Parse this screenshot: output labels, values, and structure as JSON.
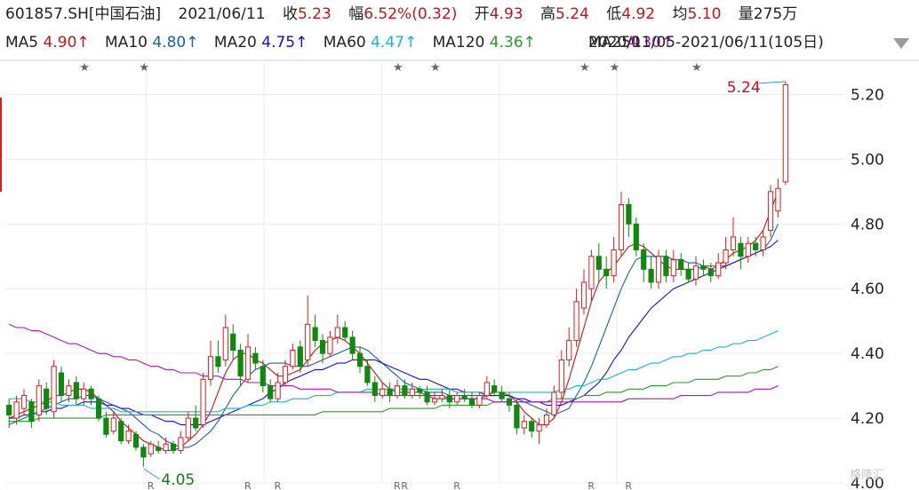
{
  "header": {
    "symbol": "601857.SH[中国石油]",
    "date": "2021/06/11",
    "close_label": "收",
    "close": "5.23",
    "change_label": "幅",
    "change": "6.52%(0.32)",
    "open_label": "开",
    "open": "4.93",
    "high_label": "高",
    "high": "5.24",
    "low_label": "低",
    "low": "4.92",
    "avg_label": "均",
    "avg": "5.10",
    "volume_label": "量",
    "volume": "275万",
    "range_text": "2020/11/05-2021/06/11(105日)"
  },
  "ma_legend": [
    {
      "name": "MA5",
      "value": "4.90",
      "arrow": "↑",
      "color": "#c0151c"
    },
    {
      "name": "MA10",
      "value": "4.80",
      "arrow": "↑",
      "color": "#1a5fa3"
    },
    {
      "name": "MA20",
      "value": "4.75",
      "arrow": "↑",
      "color": "#1111cc"
    },
    {
      "name": "MA60",
      "value": "4.47",
      "arrow": "↑",
      "color": "#1bb5c5"
    },
    {
      "name": "MA120",
      "value": "4.36",
      "arrow": "↑",
      "color": "#2b9a2b"
    },
    {
      "name": "MA250",
      "value": "4.30",
      "arrow": "↑",
      "color": "#a21ab0"
    }
  ],
  "colors": {
    "up": "#d81e1e",
    "down": "#0d8a0d",
    "grid": "#ececec",
    "text": "#222222",
    "value_red": "#c0151c"
  },
  "watermark": "格隆汇",
  "chart_data": {
    "type": "candlestick",
    "x_start": "2020/11/05",
    "x_end": "2021/06/11",
    "ylim": [
      4.0,
      5.3
    ],
    "yticks": [
      "4.00",
      "4.20",
      "4.40",
      "4.60",
      "4.80",
      "5.00",
      "5.20"
    ],
    "annotations": [
      {
        "label": "5.24",
        "type": "high"
      },
      {
        "label": "4.05",
        "type": "low"
      }
    ],
    "star_marks": 8,
    "r_marks": 9,
    "candles": [
      [
        4.24,
        4.21,
        4.26,
        4.17
      ],
      [
        4.2,
        4.25,
        4.27,
        4.18
      ],
      [
        4.23,
        4.27,
        4.29,
        4.21
      ],
      [
        4.25,
        4.19,
        4.26,
        4.17
      ],
      [
        4.21,
        4.3,
        4.32,
        4.19
      ],
      [
        4.29,
        4.23,
        4.31,
        4.21
      ],
      [
        4.22,
        4.36,
        4.38,
        4.2
      ],
      [
        4.34,
        4.27,
        4.36,
        4.25
      ],
      [
        4.27,
        4.3,
        4.32,
        4.25
      ],
      [
        4.31,
        4.26,
        4.33,
        4.24
      ],
      [
        4.26,
        4.29,
        4.31,
        4.24
      ],
      [
        4.29,
        4.26,
        4.3,
        4.24
      ],
      [
        4.26,
        4.2,
        4.27,
        4.19
      ],
      [
        4.2,
        4.15,
        4.22,
        4.14
      ],
      [
        4.16,
        4.2,
        4.22,
        4.15
      ],
      [
        4.19,
        4.13,
        4.2,
        4.12
      ],
      [
        4.13,
        4.16,
        4.18,
        4.12
      ],
      [
        4.15,
        4.11,
        4.16,
        4.1
      ],
      [
        4.11,
        4.08,
        4.12,
        4.05
      ],
      [
        4.09,
        4.12,
        4.13,
        4.08
      ],
      [
        4.11,
        4.1,
        4.13,
        4.09
      ],
      [
        4.1,
        4.12,
        4.14,
        4.09
      ],
      [
        4.12,
        4.1,
        4.13,
        4.09
      ],
      [
        4.1,
        4.14,
        4.16,
        4.09
      ],
      [
        4.14,
        4.2,
        4.22,
        4.13
      ],
      [
        4.2,
        4.17,
        4.24,
        4.16
      ],
      [
        4.18,
        4.32,
        4.34,
        4.17
      ],
      [
        4.32,
        4.39,
        4.44,
        4.3
      ],
      [
        4.39,
        4.36,
        4.44,
        4.34
      ],
      [
        4.38,
        4.48,
        4.52,
        4.36
      ],
      [
        4.46,
        4.41,
        4.49,
        4.38
      ],
      [
        4.41,
        4.33,
        4.43,
        4.3
      ],
      [
        4.32,
        4.42,
        4.46,
        4.31
      ],
      [
        4.4,
        4.37,
        4.42,
        4.35
      ],
      [
        4.36,
        4.3,
        4.38,
        4.28
      ],
      [
        4.3,
        4.26,
        4.32,
        4.25
      ],
      [
        4.26,
        4.31,
        4.34,
        4.25
      ],
      [
        4.31,
        4.36,
        4.38,
        4.3
      ],
      [
        4.36,
        4.41,
        4.43,
        4.35
      ],
      [
        4.42,
        4.36,
        4.44,
        4.34
      ],
      [
        4.38,
        4.49,
        4.58,
        4.36
      ],
      [
        4.48,
        4.44,
        4.52,
        4.42
      ],
      [
        4.44,
        4.4,
        4.46,
        4.37
      ],
      [
        4.4,
        4.45,
        4.47,
        4.39
      ],
      [
        4.45,
        4.48,
        4.52,
        4.43
      ],
      [
        4.48,
        4.45,
        4.5,
        4.44
      ],
      [
        4.45,
        4.4,
        4.47,
        4.38
      ],
      [
        4.4,
        4.36,
        4.42,
        4.34
      ],
      [
        4.36,
        4.31,
        4.38,
        4.3
      ],
      [
        4.31,
        4.27,
        4.33,
        4.25
      ],
      [
        4.27,
        4.29,
        4.31,
        4.26
      ],
      [
        4.29,
        4.27,
        4.31,
        4.25
      ],
      [
        4.27,
        4.3,
        4.32,
        4.26
      ],
      [
        4.3,
        4.27,
        4.32,
        4.26
      ],
      [
        4.27,
        4.29,
        4.31,
        4.26
      ],
      [
        4.29,
        4.28,
        4.3,
        4.26
      ],
      [
        4.28,
        4.25,
        4.3,
        4.24
      ],
      [
        4.25,
        4.26,
        4.28,
        4.24
      ],
      [
        4.26,
        4.27,
        4.29,
        4.25
      ],
      [
        4.27,
        4.25,
        4.29,
        4.23
      ],
      [
        4.25,
        4.27,
        4.28,
        4.24
      ],
      [
        4.27,
        4.26,
        4.29,
        4.25
      ],
      [
        4.26,
        4.24,
        4.28,
        4.23
      ],
      [
        4.24,
        4.27,
        4.28,
        4.23
      ],
      [
        4.27,
        4.31,
        4.33,
        4.26
      ],
      [
        4.3,
        4.28,
        4.32,
        4.27
      ],
      [
        4.28,
        4.26,
        4.3,
        4.25
      ],
      [
        4.26,
        4.24,
        4.28,
        4.22
      ],
      [
        4.24,
        4.17,
        4.26,
        4.15
      ],
      [
        4.17,
        4.19,
        4.21,
        4.15
      ],
      [
        4.19,
        4.16,
        4.2,
        4.14
      ],
      [
        4.16,
        4.18,
        4.2,
        4.12
      ],
      [
        4.18,
        4.21,
        4.23,
        4.17
      ],
      [
        4.21,
        4.28,
        4.3,
        4.2
      ],
      [
        4.28,
        4.38,
        4.41,
        4.26
      ],
      [
        4.38,
        4.44,
        4.48,
        4.36
      ],
      [
        4.44,
        4.56,
        4.6,
        4.42
      ],
      [
        4.54,
        4.62,
        4.66,
        4.52
      ],
      [
        4.6,
        4.7,
        4.72,
        4.56
      ],
      [
        4.7,
        4.66,
        4.74,
        4.62
      ],
      [
        4.66,
        4.64,
        4.7,
        4.6
      ],
      [
        4.64,
        4.72,
        4.76,
        4.62
      ],
      [
        4.72,
        4.86,
        4.9,
        4.7
      ],
      [
        4.86,
        4.8,
        4.88,
        4.76
      ],
      [
        4.8,
        4.72,
        4.82,
        4.7
      ],
      [
        4.72,
        4.66,
        4.74,
        4.62
      ],
      [
        4.66,
        4.62,
        4.7,
        4.6
      ],
      [
        4.62,
        4.7,
        4.72,
        4.6
      ],
      [
        4.7,
        4.64,
        4.72,
        4.62
      ],
      [
        4.64,
        4.69,
        4.72,
        4.62
      ],
      [
        4.69,
        4.66,
        4.71,
        4.64
      ],
      [
        4.66,
        4.63,
        4.68,
        4.62
      ],
      [
        4.63,
        4.67,
        4.7,
        4.61
      ],
      [
        4.67,
        4.66,
        4.69,
        4.64
      ],
      [
        4.66,
        4.64,
        4.68,
        4.62
      ],
      [
        4.64,
        4.68,
        4.71,
        4.63
      ],
      [
        4.68,
        4.72,
        4.76,
        4.66
      ],
      [
        4.72,
        4.76,
        4.82,
        4.7
      ],
      [
        4.74,
        4.7,
        4.76,
        4.66
      ],
      [
        4.7,
        4.74,
        4.76,
        4.68
      ],
      [
        4.74,
        4.72,
        4.76,
        4.7
      ],
      [
        4.72,
        4.76,
        4.78,
        4.7
      ],
      [
        4.78,
        4.9,
        4.92,
        4.76
      ],
      [
        4.84,
        4.91,
        4.94,
        4.82
      ],
      [
        4.93,
        5.23,
        5.24,
        4.92
      ]
    ],
    "series": [
      {
        "name": "MA5",
        "values": [
          4.2,
          4.21,
          4.22,
          4.23,
          4.24,
          4.25,
          4.27,
          4.27,
          4.28,
          4.29,
          4.29,
          4.28,
          4.26,
          4.24,
          4.22,
          4.19,
          4.17,
          4.15,
          4.13,
          4.12,
          4.11,
          4.1,
          4.1,
          4.11,
          4.13,
          4.15,
          4.18,
          4.22,
          4.28,
          4.34,
          4.38,
          4.4,
          4.4,
          4.38,
          4.37,
          4.35,
          4.33,
          4.33,
          4.34,
          4.35,
          4.38,
          4.41,
          4.43,
          4.44,
          4.45,
          4.44,
          4.42,
          4.4,
          4.37,
          4.34,
          4.31,
          4.29,
          4.28,
          4.28,
          4.28,
          4.28,
          4.27,
          4.27,
          4.27,
          4.26,
          4.26,
          4.26,
          4.26,
          4.26,
          4.27,
          4.28,
          4.28,
          4.27,
          4.25,
          4.22,
          4.2,
          4.18,
          4.18,
          4.2,
          4.25,
          4.32,
          4.4,
          4.48,
          4.56,
          4.62,
          4.65,
          4.67,
          4.7,
          4.73,
          4.74,
          4.73,
          4.71,
          4.69,
          4.67,
          4.66,
          4.66,
          4.66,
          4.66,
          4.67,
          4.66,
          4.67,
          4.69,
          4.71,
          4.72,
          4.73,
          4.75,
          4.78,
          4.84,
          4.9
        ]
      },
      {
        "name": "MA10",
        "values": [
          4.18,
          4.19,
          4.2,
          4.21,
          4.22,
          4.23,
          4.24,
          4.25,
          4.26,
          4.26,
          4.27,
          4.27,
          4.26,
          4.25,
          4.24,
          4.23,
          4.22,
          4.2,
          4.18,
          4.16,
          4.15,
          4.13,
          4.12,
          4.11,
          4.11,
          4.12,
          4.14,
          4.16,
          4.19,
          4.23,
          4.27,
          4.3,
          4.33,
          4.35,
          4.36,
          4.37,
          4.37,
          4.37,
          4.36,
          4.36,
          4.36,
          4.37,
          4.38,
          4.39,
          4.4,
          4.41,
          4.42,
          4.42,
          4.41,
          4.39,
          4.37,
          4.35,
          4.33,
          4.31,
          4.3,
          4.29,
          4.28,
          4.28,
          4.28,
          4.27,
          4.27,
          4.27,
          4.27,
          4.27,
          4.27,
          4.27,
          4.27,
          4.27,
          4.26,
          4.25,
          4.24,
          4.23,
          4.22,
          4.21,
          4.22,
          4.23,
          4.27,
          4.31,
          4.36,
          4.42,
          4.48,
          4.54,
          4.6,
          4.65,
          4.69,
          4.7,
          4.7,
          4.7,
          4.7,
          4.69,
          4.69,
          4.68,
          4.68,
          4.67,
          4.67,
          4.67,
          4.67,
          4.68,
          4.69,
          4.7,
          4.71,
          4.72,
          4.75,
          4.8
        ]
      },
      {
        "name": "MA20",
        "values": [
          4.2,
          4.2,
          4.21,
          4.21,
          4.22,
          4.22,
          4.23,
          4.23,
          4.24,
          4.24,
          4.25,
          4.25,
          4.25,
          4.24,
          4.24,
          4.23,
          4.23,
          4.22,
          4.21,
          4.21,
          4.2,
          4.19,
          4.19,
          4.18,
          4.18,
          4.18,
          4.18,
          4.19,
          4.2,
          4.21,
          4.22,
          4.23,
          4.24,
          4.25,
          4.26,
          4.28,
          4.29,
          4.31,
          4.32,
          4.33,
          4.34,
          4.35,
          4.35,
          4.36,
          4.37,
          4.37,
          4.38,
          4.38,
          4.38,
          4.38,
          4.37,
          4.36,
          4.35,
          4.34,
          4.33,
          4.32,
          4.32,
          4.31,
          4.3,
          4.29,
          4.29,
          4.28,
          4.28,
          4.28,
          4.27,
          4.27,
          4.27,
          4.27,
          4.26,
          4.26,
          4.25,
          4.25,
          4.24,
          4.24,
          4.24,
          4.25,
          4.26,
          4.27,
          4.29,
          4.31,
          4.34,
          4.38,
          4.41,
          4.45,
          4.48,
          4.51,
          4.54,
          4.56,
          4.58,
          4.6,
          4.61,
          4.62,
          4.63,
          4.64,
          4.65,
          4.66,
          4.67,
          4.68,
          4.69,
          4.7,
          4.71,
          4.72,
          4.73,
          4.75
        ]
      },
      {
        "name": "MA60",
        "values": [
          4.26,
          4.26,
          4.26,
          4.25,
          4.25,
          4.25,
          4.25,
          4.24,
          4.24,
          4.24,
          4.24,
          4.23,
          4.23,
          4.23,
          4.23,
          4.22,
          4.22,
          4.22,
          4.22,
          4.22,
          4.22,
          4.22,
          4.22,
          4.22,
          4.22,
          4.22,
          4.22,
          4.22,
          4.22,
          4.23,
          4.23,
          4.23,
          4.24,
          4.24,
          4.24,
          4.25,
          4.25,
          4.25,
          4.26,
          4.26,
          4.26,
          4.27,
          4.27,
          4.27,
          4.28,
          4.28,
          4.28,
          4.28,
          4.29,
          4.29,
          4.29,
          4.29,
          4.29,
          4.29,
          4.29,
          4.29,
          4.29,
          4.29,
          4.29,
          4.29,
          4.28,
          4.28,
          4.28,
          4.28,
          4.28,
          4.28,
          4.28,
          4.28,
          4.28,
          4.28,
          4.28,
          4.28,
          4.28,
          4.28,
          4.29,
          4.29,
          4.3,
          4.3,
          4.31,
          4.32,
          4.32,
          4.33,
          4.34,
          4.35,
          4.35,
          4.36,
          4.37,
          4.37,
          4.38,
          4.39,
          4.39,
          4.4,
          4.4,
          4.41,
          4.41,
          4.42,
          4.42,
          4.43,
          4.43,
          4.44,
          4.44,
          4.45,
          4.46,
          4.47
        ]
      },
      {
        "name": "MA120",
        "values": [
          4.19,
          4.19,
          4.19,
          4.19,
          4.2,
          4.2,
          4.2,
          4.2,
          4.2,
          4.2,
          4.2,
          4.2,
          4.2,
          4.21,
          4.21,
          4.21,
          4.21,
          4.21,
          4.21,
          4.21,
          4.21,
          4.21,
          4.21,
          4.21,
          4.21,
          4.21,
          4.21,
          4.21,
          4.21,
          4.21,
          4.21,
          4.21,
          4.21,
          4.21,
          4.21,
          4.21,
          4.21,
          4.21,
          4.21,
          4.21,
          4.21,
          4.21,
          4.22,
          4.22,
          4.22,
          4.22,
          4.22,
          4.22,
          4.22,
          4.22,
          4.22,
          4.23,
          4.23,
          4.23,
          4.23,
          4.23,
          4.23,
          4.23,
          4.24,
          4.24,
          4.24,
          4.24,
          4.24,
          4.24,
          4.24,
          4.25,
          4.25,
          4.25,
          4.25,
          4.25,
          4.25,
          4.25,
          4.25,
          4.26,
          4.26,
          4.26,
          4.26,
          4.27,
          4.27,
          4.27,
          4.28,
          4.28,
          4.28,
          4.29,
          4.29,
          4.29,
          4.3,
          4.3,
          4.3,
          4.31,
          4.31,
          4.31,
          4.32,
          4.32,
          4.32,
          4.32,
          4.33,
          4.33,
          4.33,
          4.34,
          4.34,
          4.35,
          4.35,
          4.36
        ]
      },
      {
        "name": "MA250",
        "values": [
          4.49,
          4.48,
          4.48,
          4.47,
          4.47,
          4.46,
          4.45,
          4.44,
          4.43,
          4.43,
          4.42,
          4.41,
          4.4,
          4.4,
          4.39,
          4.39,
          4.38,
          4.38,
          4.37,
          4.36,
          4.36,
          4.35,
          4.35,
          4.34,
          4.34,
          4.34,
          4.33,
          4.33,
          4.33,
          4.32,
          4.32,
          4.32,
          4.31,
          4.31,
          4.31,
          4.3,
          4.3,
          4.3,
          4.3,
          4.29,
          4.29,
          4.29,
          4.29,
          4.29,
          4.28,
          4.28,
          4.28,
          4.28,
          4.28,
          4.28,
          4.27,
          4.27,
          4.27,
          4.27,
          4.27,
          4.27,
          4.27,
          4.26,
          4.26,
          4.26,
          4.26,
          4.26,
          4.26,
          4.26,
          4.26,
          4.25,
          4.25,
          4.25,
          4.25,
          4.25,
          4.25,
          4.25,
          4.25,
          4.25,
          4.25,
          4.25,
          4.25,
          4.25,
          4.25,
          4.25,
          4.25,
          4.25,
          4.25,
          4.26,
          4.26,
          4.26,
          4.26,
          4.26,
          4.26,
          4.26,
          4.27,
          4.27,
          4.27,
          4.27,
          4.27,
          4.28,
          4.28,
          4.28,
          4.28,
          4.28,
          4.29,
          4.29,
          4.29,
          4.3
        ]
      }
    ]
  }
}
